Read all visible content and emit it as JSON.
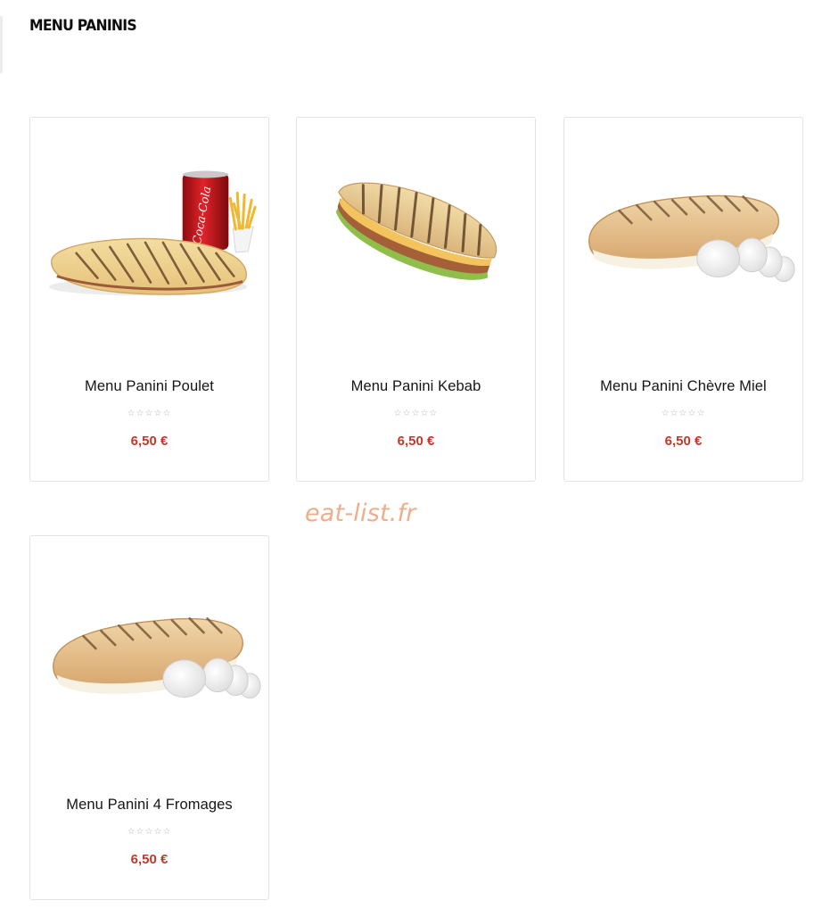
{
  "page": {
    "title": "MENU PANINIS"
  },
  "products": [
    {
      "name": "Menu Panini Poulet",
      "price": "6,50 €",
      "rating": 0,
      "stars": "☆☆☆☆☆",
      "image": "panini-with-coke-and-fries"
    },
    {
      "name": "Menu Panini Kebab",
      "price": "6,50 €",
      "rating": 0,
      "stars": "☆☆☆☆☆",
      "image": "kebab-panini"
    },
    {
      "name": "Menu Panini Chèvre Miel",
      "price": "6,50 €",
      "rating": 0,
      "stars": "☆☆☆☆☆",
      "image": "goat-cheese-panini"
    },
    {
      "name": "Menu Panini 4 Fromages",
      "price": "6,50 €",
      "rating": 0,
      "stars": "☆☆☆☆☆",
      "image": "four-cheese-panini"
    }
  ],
  "watermark": "eat-list.fr",
  "colors": {
    "price": "#c0392b",
    "watermark": "#f0ad8a",
    "card_border": "#e3e3e3"
  }
}
